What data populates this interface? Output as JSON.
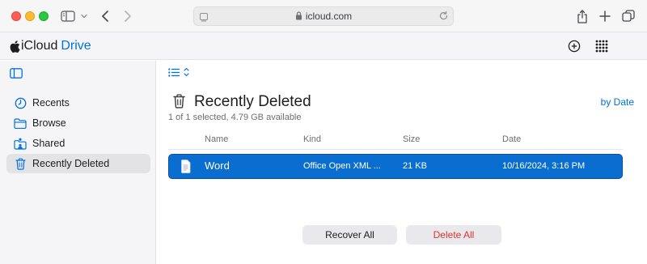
{
  "browser": {
    "url": "icloud.com"
  },
  "app": {
    "brand_name": "iCloud",
    "brand_product": "Drive",
    "accent_color": "#0071e3"
  },
  "sidebar": {
    "items": [
      {
        "label": "Recents",
        "icon": "clock-icon"
      },
      {
        "label": "Browse",
        "icon": "folder-icon"
      },
      {
        "label": "Shared",
        "icon": "shared-folder-icon"
      },
      {
        "label": "Recently Deleted",
        "icon": "trash-icon",
        "selected": true
      }
    ]
  },
  "main": {
    "title": "Recently Deleted",
    "subtitle": "1 of 1 selected, 4.79 GB available",
    "sort_label": "by Date",
    "columns": [
      "Name",
      "Kind",
      "Size",
      "Date"
    ],
    "rows": [
      {
        "name": "Word",
        "kind": "Office Open XML ...",
        "size": "21 KB",
        "date": "10/16/2024, 3:16 PM",
        "selected": true
      }
    ],
    "recover_all_label": "Recover All",
    "delete_all_label": "Delete All"
  }
}
